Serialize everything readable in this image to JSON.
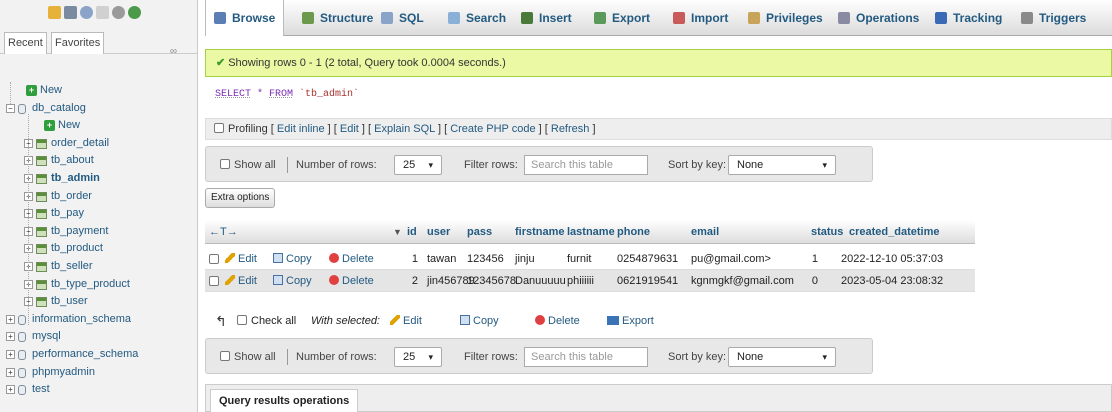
{
  "sidebar": {
    "tabs": [
      "Recent",
      "Favorites"
    ],
    "tree": [
      {
        "label": "New",
        "level": 0,
        "kind": "new"
      },
      {
        "label": "db_catalog",
        "level": 0,
        "kind": "db",
        "toggle": "−"
      },
      {
        "label": "New",
        "level": 1,
        "kind": "new"
      },
      {
        "label": "order_detail",
        "level": 1,
        "kind": "table",
        "toggle": "+"
      },
      {
        "label": "tb_about",
        "level": 1,
        "kind": "table",
        "toggle": "+"
      },
      {
        "label": "tb_admin",
        "level": 1,
        "kind": "table",
        "toggle": "+",
        "active": true
      },
      {
        "label": "tb_order",
        "level": 1,
        "kind": "table",
        "toggle": "+"
      },
      {
        "label": "tb_pay",
        "level": 1,
        "kind": "table",
        "toggle": "+"
      },
      {
        "label": "tb_payment",
        "level": 1,
        "kind": "table",
        "toggle": "+"
      },
      {
        "label": "tb_product",
        "level": 1,
        "kind": "table",
        "toggle": "+"
      },
      {
        "label": "tb_seller",
        "level": 1,
        "kind": "table",
        "toggle": "+"
      },
      {
        "label": "tb_type_product",
        "level": 1,
        "kind": "table",
        "toggle": "+"
      },
      {
        "label": "tb_user",
        "level": 1,
        "kind": "table",
        "toggle": "+"
      },
      {
        "label": "information_schema",
        "level": 0,
        "kind": "db",
        "toggle": "+"
      },
      {
        "label": "mysql",
        "level": 0,
        "kind": "db",
        "toggle": "+"
      },
      {
        "label": "performance_schema",
        "level": 0,
        "kind": "db",
        "toggle": "+"
      },
      {
        "label": "phpmyadmin",
        "level": 0,
        "kind": "db",
        "toggle": "+"
      },
      {
        "label": "test",
        "level": 0,
        "kind": "db",
        "toggle": "+"
      }
    ]
  },
  "topnav": {
    "tabs": [
      {
        "label": "Browse",
        "icon": "browse-icon",
        "color": "#5b7fb5",
        "active": true
      },
      {
        "label": "Structure",
        "icon": "structure-icon",
        "color": "#6b9a4a"
      },
      {
        "label": "SQL",
        "icon": "sql-icon",
        "color": "#8aa3c8"
      },
      {
        "label": "Search",
        "icon": "search-icon",
        "color": "#8ab0d8"
      },
      {
        "label": "Insert",
        "icon": "insert-icon",
        "color": "#4a7a3a"
      },
      {
        "label": "Export",
        "icon": "export-icon",
        "color": "#5b9a5b"
      },
      {
        "label": "Import",
        "icon": "import-icon",
        "color": "#c85a5a"
      },
      {
        "label": "Privileges",
        "icon": "privileges-icon",
        "color": "#c8a35a"
      },
      {
        "label": "Operations",
        "icon": "operations-icon",
        "color": "#8a8aa3"
      },
      {
        "label": "Tracking",
        "icon": "tracking-icon",
        "color": "#3a6ab5"
      },
      {
        "label": "Triggers",
        "icon": "triggers-icon",
        "color": "#8a8a8a"
      }
    ]
  },
  "main": {
    "success_message": "Showing rows 0 - 1 (2 total, Query took 0.0004 seconds.)",
    "sql": {
      "select": "SELECT",
      "star": " * ",
      "from": "FROM",
      "table": " `tb_admin`"
    },
    "profiling": {
      "label": "Profiling",
      "links": [
        "Edit inline",
        "Edit",
        "Explain SQL",
        "Create PHP code",
        "Refresh"
      ]
    },
    "navbar": {
      "show_all": "Show all",
      "rows_label": "Number of rows:",
      "rows_value": "25",
      "filter_label": "Filter rows:",
      "filter_placeholder": "Search this table",
      "sort_label": "Sort by key:",
      "sort_value": "None"
    },
    "extra_options": "Extra options",
    "table": {
      "arrows": "←T→",
      "sort_indicator": "▼",
      "columns": [
        "id",
        "user",
        "pass",
        "firstname",
        "lastname",
        "phone",
        "email",
        "status",
        "created_datetime"
      ],
      "row_actions": [
        "Edit",
        "Copy",
        "Delete"
      ],
      "rows": [
        [
          "1",
          "tawan",
          "123456",
          "jinju",
          "furnit",
          "0254879631",
          "pu@gmail.com>",
          "1",
          "2022-12-10 05:37:03"
        ],
        [
          "2",
          "jin456789",
          "12345678",
          "Danuuuuu",
          "phiiiiii",
          "0621919541",
          "kgnmgkf@gmail.com",
          "0",
          "2023-05-04 23:08:32"
        ]
      ]
    },
    "with_selected": {
      "check_all": "Check all",
      "label": "With selected:",
      "actions": [
        "Edit",
        "Copy",
        "Delete",
        "Export"
      ]
    },
    "query_results_operations": "Query results operations"
  }
}
